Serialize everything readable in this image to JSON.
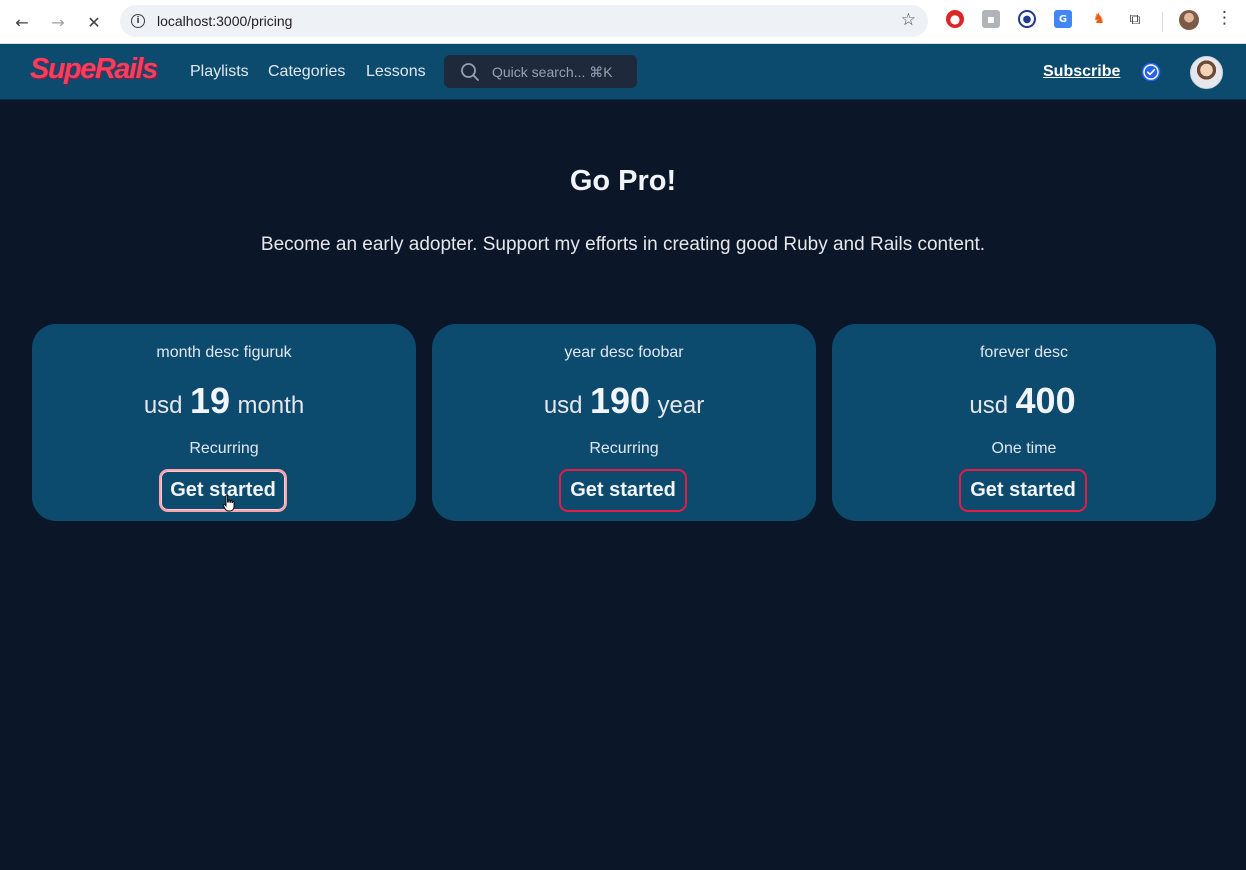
{
  "browser": {
    "url": "localhost:3000/pricing"
  },
  "header": {
    "logo_text": "SupeRails",
    "nav": [
      "Playlists",
      "Categories",
      "Lessons"
    ],
    "search_placeholder": "Quick search... ⌘K",
    "subscribe_label": "Subscribe",
    "accent": "#f43f5e",
    "bar_color": "#0c4a6e"
  },
  "hero": {
    "title": "Go Pro!",
    "subtitle": "Become an early adopter. Support my efforts in creating good Ruby and Rails content."
  },
  "plans": [
    {
      "description": "month desc figuruk",
      "currency": "usd",
      "amount": "19",
      "interval": "month",
      "billing": "Recurring",
      "cta": "Get started"
    },
    {
      "description": "year desc foobar",
      "currency": "usd",
      "amount": "190",
      "interval": "year",
      "billing": "Recurring",
      "cta": "Get started"
    },
    {
      "description": "forever desc",
      "currency": "usd",
      "amount": "400",
      "interval": "",
      "billing": "One time",
      "cta": "Get started"
    }
  ]
}
